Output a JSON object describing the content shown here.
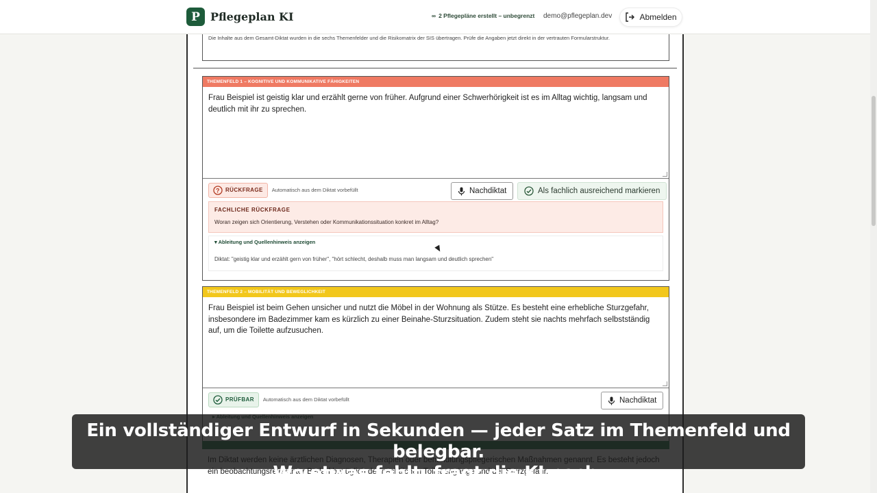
{
  "app": {
    "name": "Pflegeplan KI",
    "logo_letter": "P",
    "usage": "2 Pflegepläne erstellt – unbegrenzt",
    "usage_icon": "infinity-icon",
    "user_email": "demo@pflegeplan.dev",
    "logout_label": "Abmelden"
  },
  "intro_text": "Die Inhalte aus dem Gesamt-Diktat wurden in die sechs Themenfelder und die Risikomatrix der SIS übertragen. Prüfe die Angaben jetzt direkt in der vertrauten Formularstruktur.",
  "themenfeld1": {
    "header": "Themenfeld 1 – Kognitive und kommunikative Fähigkeiten",
    "header_color": "#ef7a63",
    "text": "Frau Beispiel ist geistig klar und erzählt gerne von früher. Aufgrund einer Schwerhörigkeit ist es im Alltag wichtig, langsam und deutlich mit ihr zu sprechen.",
    "status": "RÜCKFRAGE",
    "auto_note": "Automatisch aus dem Diktat vorbefüllt",
    "dictate_label": "Nachdiktat",
    "sufficient_label": "Als fachlich ausreichend markieren",
    "question_title": "FACHLICHE RÜCKFRAGE",
    "question_text": "Woran zeigen sich Orientierung, Verstehen oder Kommunikationssituation konkret im Alltag?",
    "derive_toggle": "▾ Ableitung und Quellenhinweis anzeigen",
    "source": "Diktat: \"geistig klar und erzählt gern von früher\", \"hört schlecht, deshalb muss man langsam und deutlich sprechen\""
  },
  "themenfeld2": {
    "header": "Themenfeld 2 – Mobilität und Beweglichkeit",
    "header_color": "#f2c71c",
    "text": "Frau Beispiel ist beim Gehen unsicher und nutzt die Möbel in der Wohnung als Stütze. Es besteht eine erhebliche Sturzgefahr, insbesondere im Badezimmer kam es kürzlich zu einer Beinahe-Sturzsituation. Zudem steht sie nachts mehrfach selbstständig auf, um die Toilette aufzusuchen.",
    "status": "PRÜFBAR",
    "auto_note": "Automatisch aus dem Diktat vorbefüllt",
    "dictate_label": "Nachdiktat",
    "derive_toggle": "▸ Ableitung und Quellenhinweis anzeigen"
  },
  "themenfeld3": {
    "header_color": "#2a7a4c",
    "text": "Im Diktat werden keine ärztlichen Diagnosen, Therapien oder behandlungspflegerischen Maßnahmen genannt. Es besteht jedoch ein beobachtungsrelevanter Bedarf bezüglich der nächtlichen Toilettengänge und der Sturzgefahr."
  },
  "caption": {
    "line1": "Ein vollständiger Entwurf in Sekunden — jeder Satz im Themenfeld und belegbar.",
    "line2": "Wo etwas fehlt, fragt die KI nach."
  }
}
